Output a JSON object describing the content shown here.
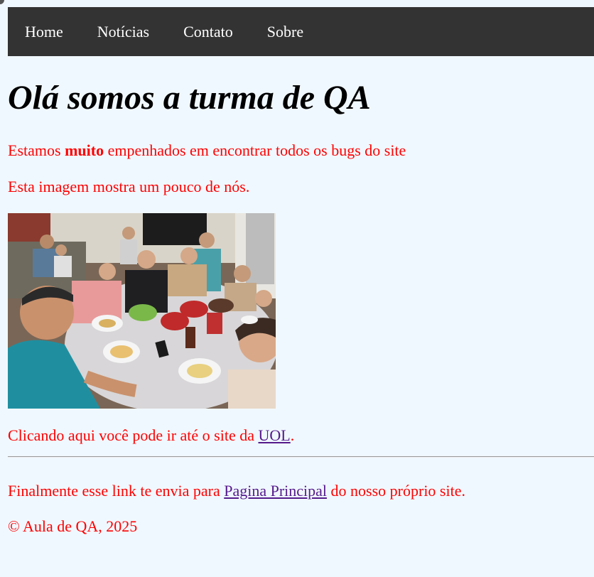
{
  "nav": {
    "items": [
      "Home",
      "Notícias",
      "Contato",
      "Sobre"
    ]
  },
  "heading": "Olá somos a turma de QA",
  "intro": {
    "before": "Estamos ",
    "bold": "muito",
    "after": " empenhados em encontrar todos os bugs do site"
  },
  "image_caption": "Esta imagem mostra um pouco de nós.",
  "uol_line": {
    "before": "Clicando aqui você pode ir até o site da ",
    "link": "UOL",
    "after": "."
  },
  "home_line": {
    "before": "Finalmente esse link te envia para ",
    "link": "Pagina Principal",
    "after": " do nosso próprio site."
  },
  "footer": "© Aula de QA, 2025",
  "colors": {
    "nav_bg": "#333333",
    "page_bg": "#f0f8ff",
    "text_red": "#ff0000",
    "link_visited": "#551a8b"
  }
}
